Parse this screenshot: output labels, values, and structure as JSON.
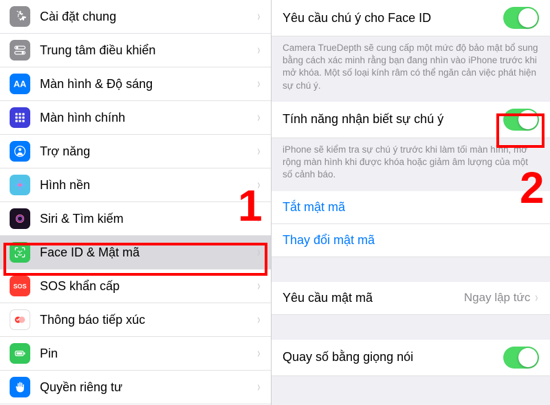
{
  "left": {
    "items": [
      {
        "label": "Cài đặt chung",
        "icon": "gear",
        "bg": "#8e8e93"
      },
      {
        "label": "Trung tâm điều khiển",
        "icon": "switches",
        "bg": "#8e8e93"
      },
      {
        "label": "Màn hình & Độ sáng",
        "icon": "aa",
        "bg": "#007aff"
      },
      {
        "label": "Màn hình chính",
        "icon": "grid",
        "bg": "#3f3ddb"
      },
      {
        "label": "Trợ năng",
        "icon": "person",
        "bg": "#007aff"
      },
      {
        "label": "Hình nền",
        "icon": "flower",
        "bg": "#52c3e8"
      },
      {
        "label": "Siri & Tìm kiếm",
        "icon": "siri",
        "bg": "#1b1024"
      },
      {
        "label": "Face ID & Mật mã",
        "icon": "face",
        "bg": "#34c759",
        "selected": true
      },
      {
        "label": "SOS khẩn cấp",
        "icon": "sos",
        "bg": "#ff3b30"
      },
      {
        "label": "Thông báo tiếp xúc",
        "icon": "exposure",
        "bg": "#ffffff"
      },
      {
        "label": "Pin",
        "icon": "battery",
        "bg": "#34c759"
      },
      {
        "label": "Quyền riêng tư",
        "icon": "hand",
        "bg": "#007aff"
      }
    ]
  },
  "right": {
    "attention_faceid_label": "Yêu cầu chú ý cho Face ID",
    "attention_faceid_on": true,
    "attention_faceid_desc": "Camera TrueDepth sẽ cung cấp một mức độ bảo mật bổ sung bằng cách xác minh rằng bạn đang nhìn vào iPhone trước khi mở khóa. Một số loại kính râm có thể ngăn cản việc phát hiện sự chú ý.",
    "attention_aware_label": "Tính năng nhận biết sự chú ý",
    "attention_aware_on": true,
    "attention_aware_desc": "iPhone sẽ kiểm tra sự chú ý trước khi làm tối màn hình, mở rộng màn hình khi được khóa hoặc giảm âm lượng của một số cảnh báo.",
    "turn_off_passcode": "Tắt mật mã",
    "change_passcode": "Thay đổi mật mã",
    "require_passcode_label": "Yêu cầu mật mã",
    "require_passcode_value": "Ngay lập tức",
    "voice_dial_label": "Quay số bằng giọng nói",
    "voice_dial_on": true
  },
  "annotations": {
    "num1": "1",
    "num2": "2"
  }
}
